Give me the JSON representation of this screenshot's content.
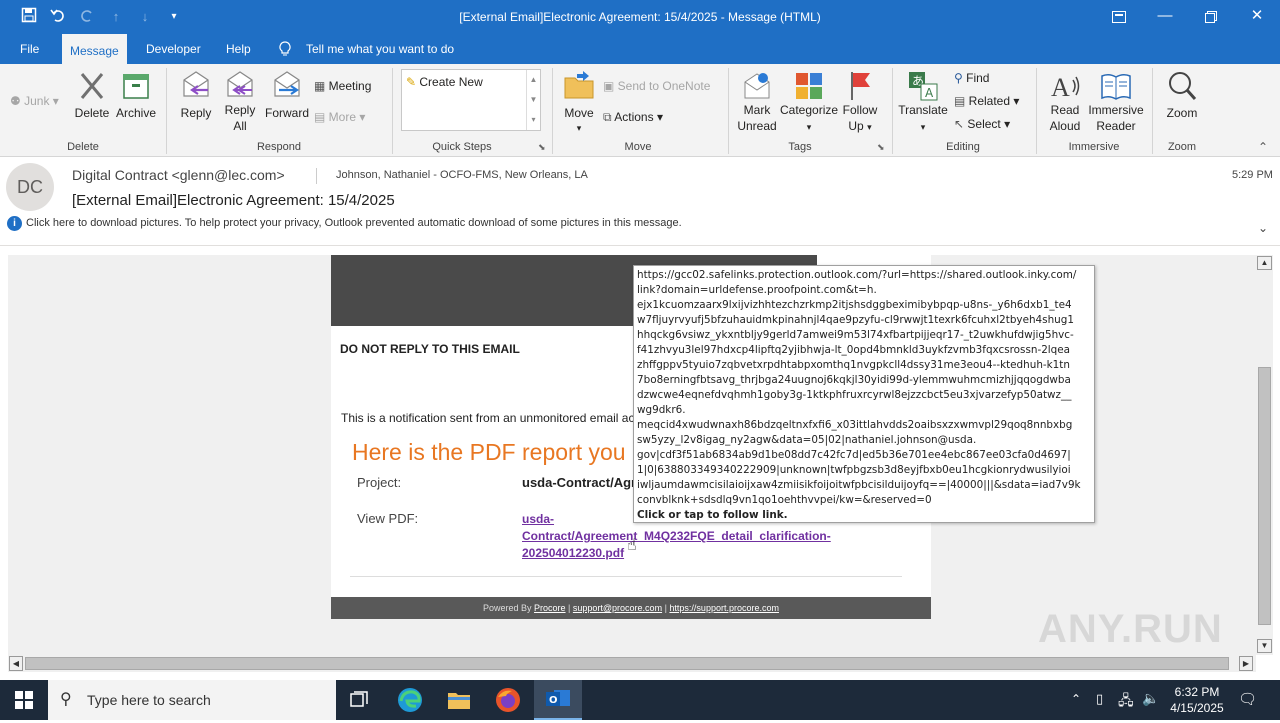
{
  "window": {
    "title": "[External Email]Electronic Agreement: 15/4/2025  -  Message (HTML)"
  },
  "tabs": [
    "File",
    "Message",
    "Developer",
    "Help"
  ],
  "tell_me": "Tell me what you want to do",
  "ribbon": {
    "delete_group": {
      "junk": "Junk",
      "delete": "Delete",
      "archive": "Archive",
      "label": "Delete"
    },
    "respond_group": {
      "reply": "Reply",
      "reply_all_1": "Reply",
      "reply_all_2": "All",
      "forward": "Forward",
      "meeting": "Meeting",
      "more": "More",
      "label": "Respond"
    },
    "quick_steps": {
      "create_new": "Create New",
      "label": "Quick Steps"
    },
    "move_group": {
      "move": "Move",
      "onenote": "Send to OneNote",
      "actions": "Actions",
      "label": "Move"
    },
    "tags_group": {
      "mark_unread_1": "Mark",
      "mark_unread_2": "Unread",
      "categorize": "Categorize",
      "follow_up_1": "Follow",
      "follow_up_2": "Up",
      "label": "Tags"
    },
    "editing_group": {
      "translate": "Translate",
      "find": "Find",
      "related": "Related",
      "select": "Select",
      "label": "Editing"
    },
    "immersive_group": {
      "read_aloud_1": "Read",
      "read_aloud_2": "Aloud",
      "immersive_1": "Immersive",
      "immersive_2": "Reader",
      "label": "Immersive"
    },
    "zoom_group": {
      "zoom": "Zoom",
      "label": "Zoom"
    }
  },
  "message": {
    "avatar_initials": "DC",
    "from": "Digital Contract <glenn@lec.com>",
    "to": "Johnson, Nathaniel - OCFO-FMS, New Orleans, LA",
    "time": "5:29 PM",
    "subject": "[External Email]Electronic Agreement: 15/4/2025",
    "info_bar": "Click here to download pictures. To help protect your privacy, Outlook prevented automatic download of some pictures in this message."
  },
  "email_body": {
    "do_not_reply": "DO NOT REPLY TO THIS EMAIL",
    "notification": "This is a notification sent from an unmonitored email ac",
    "heading": "Here is the PDF report you",
    "project_label": "Project:",
    "project_value": "usda-Contract/Agr",
    "view_pdf_label": "View PDF:",
    "pdf_link_1": "usda-",
    "pdf_link_2": "Contract/Agreement_M4Q232FQE_detail_clarification-",
    "pdf_link_3": "202504012230.pdf",
    "footer_powered": "Powered By ",
    "footer_procore": "Procore",
    "footer_sep": " | ",
    "footer_email": "support@procore.com",
    "footer_site": "https://support.procore.com"
  },
  "tooltip": {
    "lines": [
      "https://gcc02.safelinks.protection.outlook.com/?url=https://shared.outlook.inky.com/",
      "link?domain=urldefense.proofpoint.com&t=h.",
      "ejx1kcuomzaarx9lxijvizhhtezchzrkmp2itjshsdggbeximibybpqp-u8ns-_y6h6dxb1_te4",
      "w7fljuyrvyufj5bfzuhauidmkpinahnjl4qae9pzyfu-cl9rwwjt1texrk6fcuhxl2tbyeh4shug1",
      "hhqckg6vsiwz_ykxntbljy9gerld7amwei9m53l74xfbartpijjeqr17-_t2uwkhufdwjig5hvc-",
      "f41zhvyu3lel97hdxcp4lipftq2yjibhwja-lt_0opd4bmnkld3uykfzvmb3fqxcsrossn-2lqea",
      "zhffgppv5tyuio7zqbvetxrpdhtabpxomthq1nvgpkcll4dssy31me3eou4--ktedhuh-k1tn",
      "7bo8erningfbtsavg_thrjbga24uugnoj6kqkjl30yidi99d-ylemmwuhmcmizhjjqqogdwba",
      "dzwcwe4eqnefdvqhmh1goby3g-1ktkphfruxrcyrwl8ejzzcbct5eu3xjvarzefyp50atwz__",
      "wg9dkr6.",
      "meqcid4xwudwnaxh86bdzqeltnxfxfi6_x03ittlahvdds2oaibsxzxwmvpl29qoq8nnbxbg",
      "sw5yzy_l2v8igag_ny2agw&data=05|02|nathaniel.johnson@usda.",
      "gov|cdf3f51ab6834ab9d1be08dd7c42fc7d|ed5b36e701ee4ebc867ee03cfa0d4697|",
      "1|0|638803349340222909|unknown|twfpbgzsb3d8eyjfbxb0eu1hcgkionrydwusilyioi",
      "iwljaumdawmcisilaioijxaw4zmiisikfoijoitwfpbcisilduijoyfq==|40000|||&sdata=iad7v9k",
      "convblknk+sdsdlq9vn1qo1oehthvvpei/kw=&reserved=0"
    ],
    "follow": "Click or tap to follow link."
  },
  "taskbar": {
    "search_placeholder": "Type here to search",
    "time": "6:32 PM",
    "date": "4/15/2025"
  },
  "watermark": "ANY.RUN",
  "colors": {
    "accent": "#1f6fc5",
    "heading_orange": "#e87722",
    "link_purple": "#7030a0",
    "banner": "#4a4a4a",
    "taskbar": "#1d2a3a"
  }
}
